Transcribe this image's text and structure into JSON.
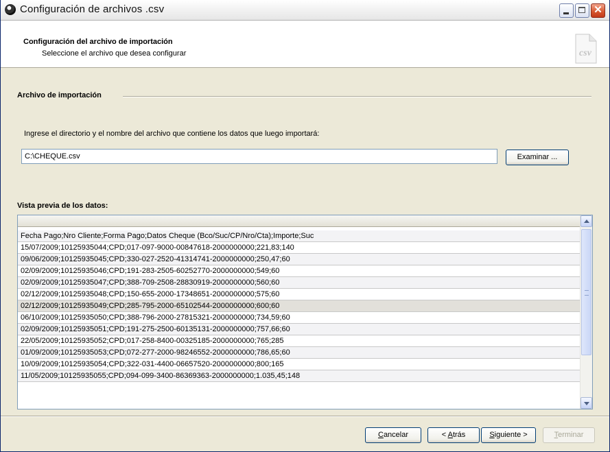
{
  "window": {
    "title": "Configuración de archivos .csv"
  },
  "header": {
    "title": "Configuración del archivo de importación",
    "subtitle": "Seleccione el archivo que desea configurar",
    "icon": "csv-file-icon",
    "icon_label": "csv"
  },
  "import_section": {
    "label": "Archivo de importación",
    "instruction": "Ingrese el directorio y el nombre del archivo que contiene los datos que luego importará:",
    "path_value": "C:\\CHEQUE.csv",
    "browse_label": "Examinar ..."
  },
  "preview": {
    "label": "Vista previa de los datos:",
    "rows": [
      "Fecha Pago;Nro Cliente;Forma Pago;Datos Cheque (Bco/Suc/CP/Nro/Cta);Importe;Suc",
      "15/07/2009;10125935044;CPD;017-097-9000-00847618-2000000000;221,83;140",
      "09/06/2009;10125935045;CPD;330-027-2520-41314741-2000000000;250,47;60",
      "02/09/2009;10125935046;CPD;191-283-2505-60252770-2000000000;549;60",
      "02/09/2009;10125935047;CPD;388-709-2508-28830919-2000000000;560;60",
      "02/12/2009;10125935048;CPD;150-655-2000-17348651-2000000000;575;60",
      "02/12/2009;10125935049;CPD;285-795-2000-65102544-2000000000;600;60",
      "06/10/2009;10125935050;CPD;388-796-2000-27815321-2000000000;734,59;60",
      "02/09/2009;10125935051;CPD;191-275-2500-60135131-2000000000;757,66;60",
      "22/05/2009;10125935052;CPD;017-258-8400-00325185-2000000000;765;285",
      "01/09/2009;10125935053;CPD;072-277-2000-98246552-2000000000;786,65;60",
      "10/09/2009;10125935054;CPD;322-031-4400-06657520-2000000000;800;165",
      "11/05/2009;10125935055;CPD;094-099-3400-86369363-2000000000;1.035,45;148"
    ]
  },
  "footer": {
    "cancel": {
      "mnemonic": "C",
      "rest": "ancelar"
    },
    "back": {
      "prefix": "< ",
      "mnemonic": "A",
      "rest": "trás"
    },
    "next": {
      "mnemonic": "S",
      "rest": "iguiente >"
    },
    "finish": {
      "mnemonic": "T",
      "rest": "erminar"
    }
  },
  "colors": {
    "window_face": "#ece9d8",
    "input_border": "#7f9db9",
    "close_button": "#d4542d"
  }
}
